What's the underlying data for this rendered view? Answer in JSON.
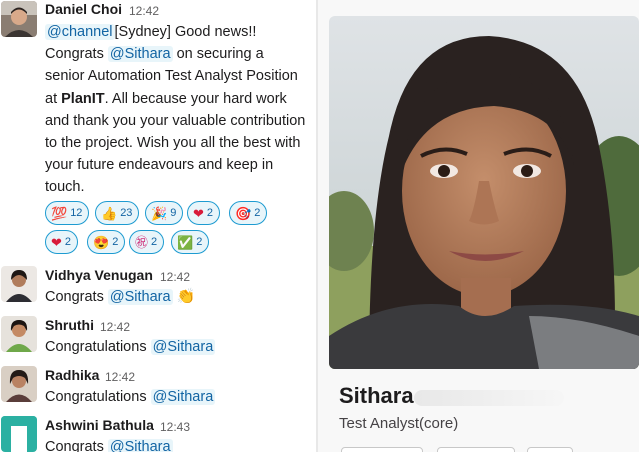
{
  "messages": [
    {
      "author": "Daniel Choi",
      "time": "12:42",
      "text": {
        "channel_mention": "@channel",
        "prefix": "[Sydney] Good news!! Congrats ",
        "user_mention": "@Sithara",
        "middle": " on securing a senior Automation Test Analyst Position at ",
        "company": "PlanIT",
        "suffix": ". All because your hard work and thank you your valuable contribution to the project. Wish you all the best with your future endeavours and keep in touch."
      },
      "reactions": [
        {
          "icon": "hundred-points-icon",
          "glyph": "💯",
          "count": "12"
        },
        {
          "icon": "thumbs-up-icon",
          "glyph": "👍",
          "count": "23"
        },
        {
          "icon": "party-popper-icon",
          "glyph": "🎉",
          "count": "9"
        },
        {
          "icon": "red-heart-icon",
          "glyph": "❤",
          "count": "2"
        },
        {
          "icon": "direct-hit-icon",
          "glyph": "🎯",
          "count": "2"
        },
        {
          "icon": "red-heart-icon",
          "glyph": "❤",
          "count": "2"
        },
        {
          "icon": "heart-eyes-icon",
          "glyph": "😍",
          "count": "2"
        },
        {
          "icon": "congratulations-icon",
          "glyph": "㊗",
          "count": "2"
        },
        {
          "icon": "check-mark-icon",
          "glyph": "✅",
          "count": "2"
        }
      ]
    },
    {
      "author": "Vidhya Venugan",
      "time": "12:42",
      "text": {
        "prefix": "Congrats ",
        "user_mention": "@Sithara",
        "emoji": "👏",
        "emoji_icon": "clapping-hands-icon"
      }
    },
    {
      "author": "Shruthi",
      "time": "12:42",
      "text": {
        "prefix": "Congratulations ",
        "user_mention": "@Sithara"
      }
    },
    {
      "author": "Radhika",
      "time": "12:42",
      "text": {
        "prefix": "Congratulations ",
        "user_mention": "@Sithara"
      }
    },
    {
      "author": "Ashwini Bathula",
      "time": "12:43",
      "text": {
        "prefix": "Congrats ",
        "user_mention": "@Sithara"
      }
    }
  ],
  "profile": {
    "name": "Sithara",
    "title": "Test Analyst(core)"
  },
  "colors": {
    "mention_bg": "#e8f5fa",
    "mention_text": "#1264a3",
    "reaction_border": "#1d9bd1"
  }
}
